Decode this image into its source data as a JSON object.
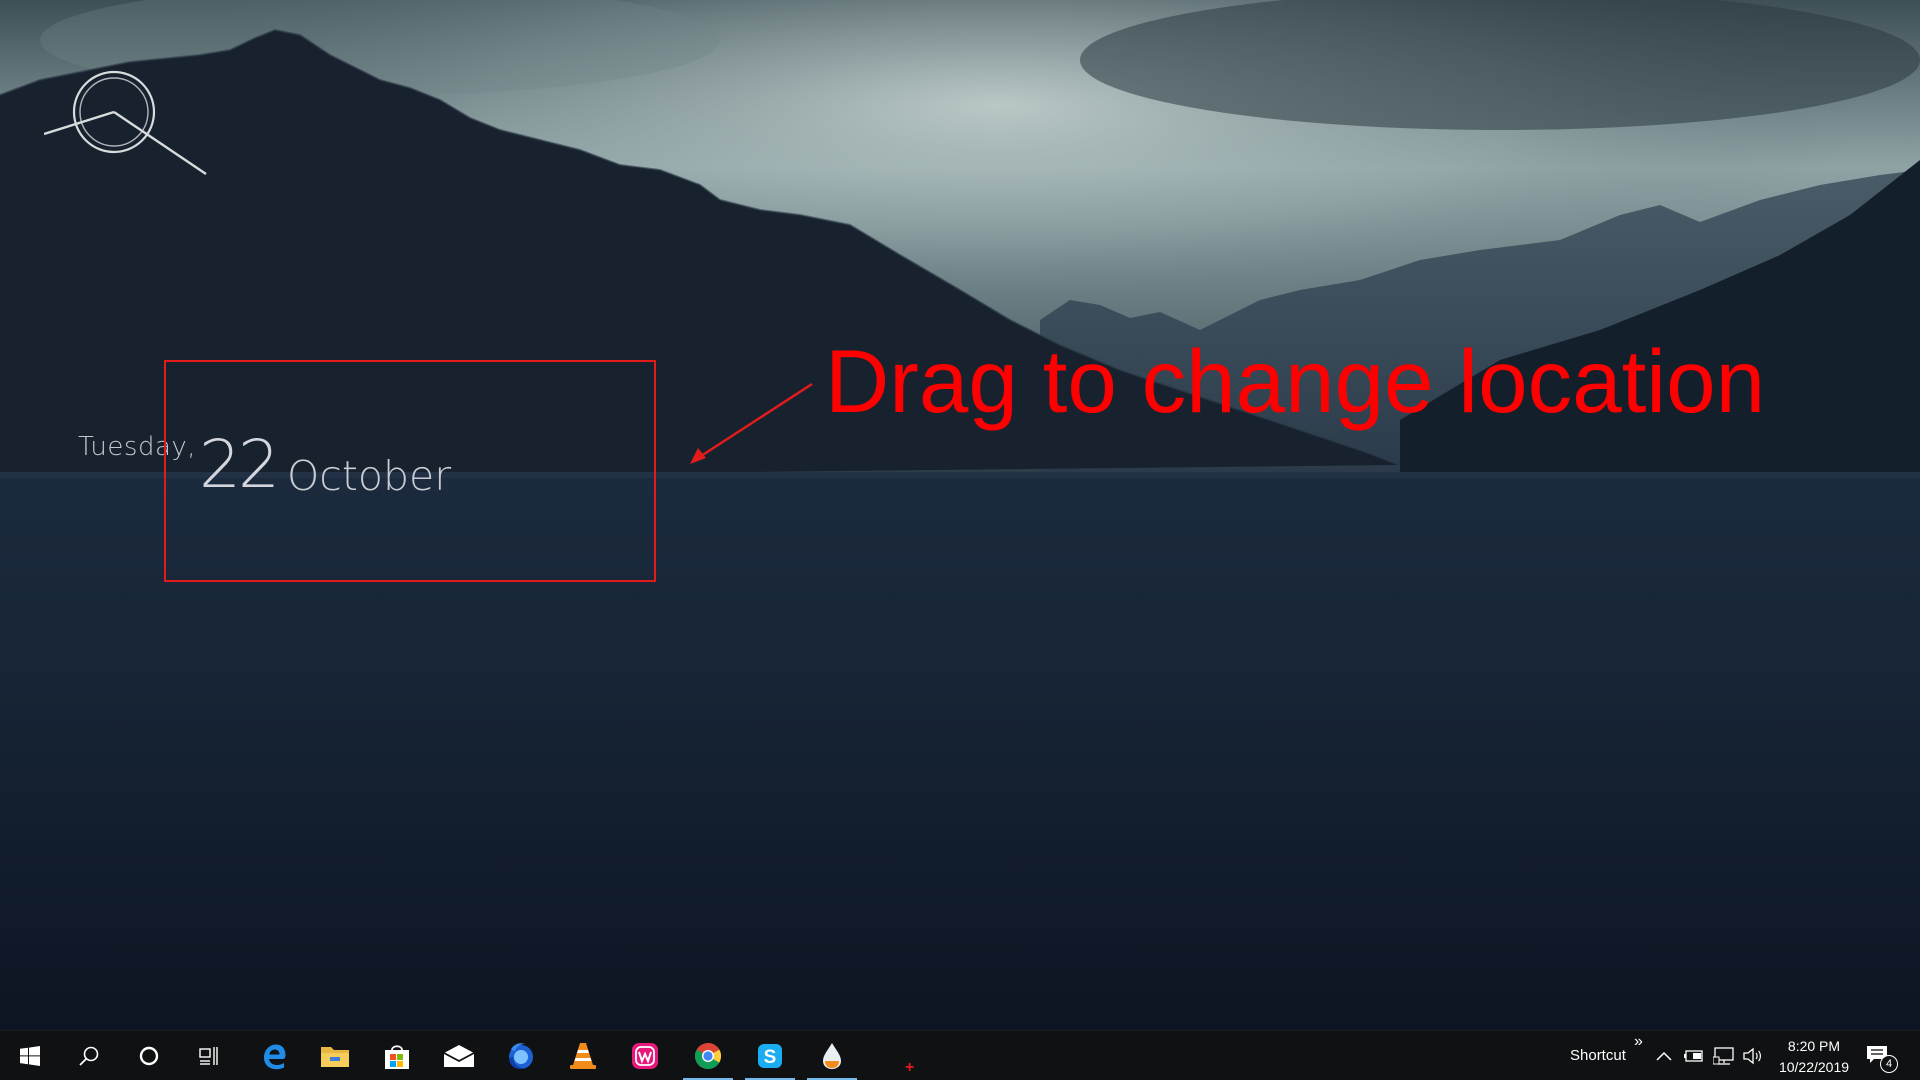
{
  "desktop": {
    "widget": {
      "weekday": "Tuesday,",
      "day": "22",
      "month": "October"
    },
    "annotation": {
      "text": "Drag to change location",
      "color": "#ff0000"
    }
  },
  "taskbar": {
    "pinned": [
      {
        "name": "start-button",
        "icon": "windows-logo-icon"
      },
      {
        "name": "search-button",
        "icon": "search-icon"
      },
      {
        "name": "cortana-button",
        "icon": "cortana-circle-icon"
      },
      {
        "name": "task-view-button",
        "icon": "task-view-icon"
      },
      {
        "name": "edge-button",
        "icon": "edge-icon"
      },
      {
        "name": "file-explorer-button",
        "icon": "folder-icon"
      },
      {
        "name": "store-button",
        "icon": "store-icon"
      },
      {
        "name": "mail-button",
        "icon": "mail-icon"
      },
      {
        "name": "firefox-button",
        "icon": "firefox-icon"
      },
      {
        "name": "vlc-button",
        "icon": "vlc-cone-icon"
      },
      {
        "name": "wamp-button",
        "icon": "wamp-icon"
      },
      {
        "name": "chrome-button",
        "icon": "chrome-icon",
        "running": true
      },
      {
        "name": "skype-button",
        "icon": "skype-icon",
        "running": true
      },
      {
        "name": "drop-app-button",
        "icon": "droplet-icon",
        "running": true
      }
    ],
    "tray": {
      "toolbar_label": "Shortcut",
      "overflow_glyph": "»",
      "time": "8:20 PM",
      "date": "10/22/2019",
      "notification_count": "4"
    },
    "accent_color": "#76b9ed"
  }
}
